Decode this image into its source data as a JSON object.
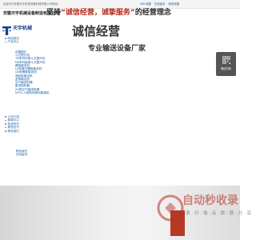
{
  "topbar": {
    "welcome": "欢迎访问安徽天宇机械设备制造有限公司网站！",
    "links": [
      "XML地图",
      "在线留言",
      "网站地图"
    ]
  },
  "company_name": "安徽天宇机械设备制造有限公司",
  "logo": {
    "text": "天宇机械"
  },
  "nav": {
    "items": [
      {
        "label": "网站首页"
      },
      {
        "label": "产品中心"
      }
    ],
    "products": [
      "设备图片",
      "斗式提升机",
      "TH系列环链斗式提升机",
      "NE系列板链斗式提升机",
      "螺旋输送机",
      "LS型管式螺旋输送机",
      "GX型螺旋输送机",
      "埋刮板输送机",
      "皮带输送机",
      "空气输送斜槽",
      "星型卸料器",
      "XZ型空气输送斜槽",
      "NYGL-G型粉体移动散装机"
    ],
    "section2": [
      "公司介绍",
      "新闻中心",
      "技术知识",
      "荣誉证书",
      "联系我们"
    ],
    "section3": [
      "联系我们",
      "在线留言"
    ]
  },
  "qr": {
    "label": "微信扫码"
  },
  "banner": {
    "line1_prefix": "坚持",
    "line1_quote": "“诚信经营，诚挚服务”",
    "line1_suffix": "的经营理念",
    "line2": "诚信经营",
    "line3": "专业输送设备厂家"
  },
  "watermark": {
    "title": "自动秒收录",
    "subtitle": "源 · 扫 · 端 · 品 · 数 · 据 · 分 · 享"
  }
}
